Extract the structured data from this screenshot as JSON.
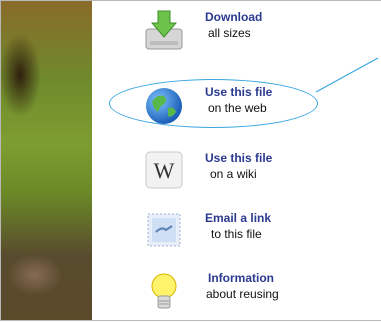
{
  "items": [
    {
      "title": "Download",
      "subtitle": "all sizes",
      "icon": "download-drive-icon"
    },
    {
      "title": "Use this file",
      "subtitle": "on the web",
      "icon": "globe-icon"
    },
    {
      "title": "Use this file",
      "subtitle": "on a wiki",
      "icon": "wikipedia-w-icon"
    },
    {
      "title": "Email a link",
      "subtitle": "to this file",
      "icon": "envelope-stamp-icon"
    },
    {
      "title": "Information",
      "subtitle": "about reusing",
      "icon": "lightbulb-icon"
    }
  ],
  "colors": {
    "link": "#2b3a8f",
    "highlight": "#3aa6e0"
  }
}
